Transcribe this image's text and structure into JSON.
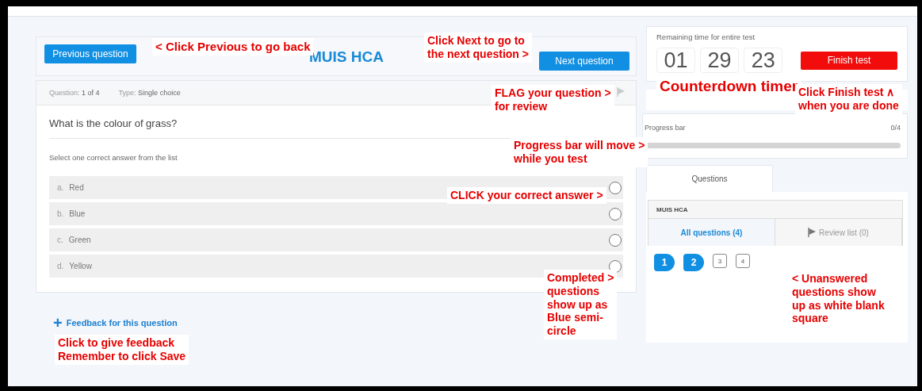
{
  "nav": {
    "previous": "Previous question",
    "title": "MUIS HCA",
    "next": "Next question"
  },
  "question": {
    "number_label": "Question:",
    "number": "1 of 4",
    "type_label": "Type:",
    "type": "Single choice",
    "text": "What is the colour of grass?",
    "instruction": "Select one correct answer from the list",
    "options": [
      {
        "letter": "a.",
        "text": "Red",
        "selected": false
      },
      {
        "letter": "b.",
        "text": "Blue",
        "selected": false
      },
      {
        "letter": "c.",
        "text": "Green",
        "selected": false
      },
      {
        "letter": "d.",
        "text": "Yellow",
        "selected": false
      }
    ]
  },
  "feedback": {
    "icon": "+",
    "label": "Feedback for this question"
  },
  "timer": {
    "label": "Remaining time for entire test",
    "hours": "01",
    "minutes": "29",
    "seconds": "23",
    "finish": "Finish test"
  },
  "progress": {
    "label": "Progress bar",
    "count": "0/4",
    "level": 0
  },
  "questions_panel": {
    "tabs": [
      {
        "label": "Questions",
        "selected": true
      }
    ],
    "section": "MUIS HCA",
    "filters": [
      {
        "kind": "all",
        "label": "All questions (4)",
        "selected": true
      },
      {
        "kind": "review",
        "label": "Review list (0)",
        "selected": false
      }
    ],
    "items": [
      {
        "label": "1",
        "answered": true
      },
      {
        "label": "2",
        "answered": true
      },
      {
        "label": "3",
        "answered": false
      },
      {
        "label": "4",
        "answered": false
      }
    ]
  },
  "annotations": [
    {
      "lines": [
        "< Click Previous to go back"
      ]
    },
    {
      "lines": [
        "Click Next to go to",
        "the next question >"
      ]
    },
    {
      "lines": [
        "Counterdown timer"
      ]
    },
    {
      "lines": [
        "FLAG your question >",
        "for review"
      ]
    },
    {
      "lines": [
        "Click Finish test ∧",
        "when you are done"
      ]
    },
    {
      "lines": [
        "Progress bar will move >",
        "while you test"
      ]
    },
    {
      "lines": [
        "CLICK your correct answer >"
      ]
    },
    {
      "lines": [
        "Completed >",
        "questions",
        "show up as",
        "Blue semi-",
        "circle"
      ]
    },
    {
      "lines": [
        "< Unanswered",
        "questions show",
        "up as white blank",
        "square"
      ]
    },
    {
      "lines": [
        "Click to give feedback",
        "Remember to click Save"
      ]
    }
  ]
}
